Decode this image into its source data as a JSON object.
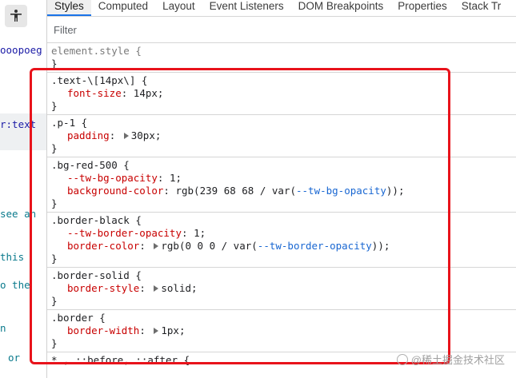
{
  "left_tree": {
    "fragments": [
      "ooopoeg",
      "r:text",
      "see an",
      "this",
      "o the",
      "n",
      "or"
    ]
  },
  "tabs": [
    "Styles",
    "Computed",
    "Layout",
    "Event Listeners",
    "DOM Breakpoints",
    "Properties",
    "Stack Tr"
  ],
  "active_tab": "Styles",
  "filter": {
    "placeholder": "Filter"
  },
  "element_style": {
    "selector": "element.style {",
    "close": "}"
  },
  "rules": [
    {
      "selector": ".text-\\[14px\\] {",
      "decls": [
        {
          "prop": "font-size",
          "value": "14px"
        }
      ]
    },
    {
      "selector": ".p-1 {",
      "decls": [
        {
          "prop": "padding",
          "value": "30px",
          "expandable": true
        }
      ]
    },
    {
      "selector": ".bg-red-500 {",
      "decls": [
        {
          "prop": "--tw-bg-opacity",
          "value": "1"
        },
        {
          "prop": "background-color",
          "value_pre": "rgb(239 68 68 / var(",
          "value_var": "--tw-bg-opacity",
          "value_post": "));"
        }
      ]
    },
    {
      "selector": ".border-black {",
      "decls": [
        {
          "prop": "--tw-border-opacity",
          "value": "1"
        },
        {
          "prop": "border-color",
          "value_pre": "rgb(0 0 0 / var(",
          "value_var": "--tw-border-opacity",
          "value_post": "));",
          "expandable": true
        }
      ]
    },
    {
      "selector": ".border-solid {",
      "decls": [
        {
          "prop": "border-style",
          "value": "solid",
          "expandable": true
        }
      ]
    },
    {
      "selector": ".border {",
      "decls": [
        {
          "prop": "border-width",
          "value": "1px",
          "expandable": true
        }
      ]
    }
  ],
  "partial_rule": "* , ::before, ::after {",
  "watermark": "@稀土掘金技术社区",
  "colors": {
    "highlight": "#e8131b",
    "property": "#c80000",
    "variable": "#1967d2",
    "active_tab_underline": "#1a73e8"
  }
}
